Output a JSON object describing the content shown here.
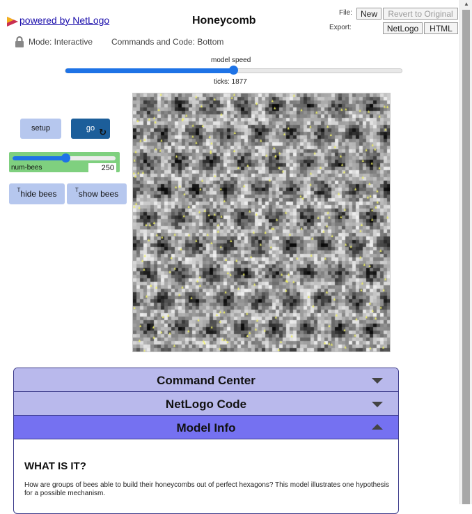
{
  "header": {
    "powered_by": "powered by NetLogo",
    "title": "Honeycomb",
    "file_label": "File:",
    "export_label": "Export:",
    "new_label": "New",
    "revert_label": "Revert to Original",
    "export_netlogo_label": "NetLogo",
    "export_html_label": "HTML",
    "mode_text": "Mode: Interactive",
    "commands_code_text": "Commands and Code: Bottom",
    "icons": {
      "logo": "netlogo-logo-icon",
      "lock": "lock-icon"
    }
  },
  "speed": {
    "label": "model speed",
    "value_fraction": 0.5,
    "ticks_text": "ticks: 1877"
  },
  "widgets": {
    "setup_label": "setup",
    "go_label": "go",
    "go_forever_icon": "forever-loop-icon",
    "slider": {
      "label": "num-bees",
      "value": "250",
      "fraction": 0.52
    },
    "hide_label": "hide bees",
    "show_label": "show bees",
    "toggle_marker": "T"
  },
  "view": {
    "description_colors": {
      "patch_dark": "#1a1a1a",
      "patch_light": "#e6e6e6",
      "bee": "#f2f261"
    },
    "bee_count_visible": 250
  },
  "colors": {
    "button_blue": "#b6c7ee",
    "go_active": "#1c5e9a",
    "slider_green": "#7fd07f",
    "tab_inactive": "#b9b9ec",
    "tab_active": "#7571f1",
    "accent_blue": "#1e73e6"
  },
  "panel": {
    "tabs": [
      {
        "label": "Command Center",
        "expanded": false
      },
      {
        "label": "NetLogo Code",
        "expanded": false
      },
      {
        "label": "Model Info",
        "expanded": true
      }
    ],
    "info_heading": "WHAT IS IT?",
    "info_text": "How are groups of bees able to build their honeycombs out of perfect hexagons? This model illustrates one hypothesis for a possible mechanism."
  }
}
